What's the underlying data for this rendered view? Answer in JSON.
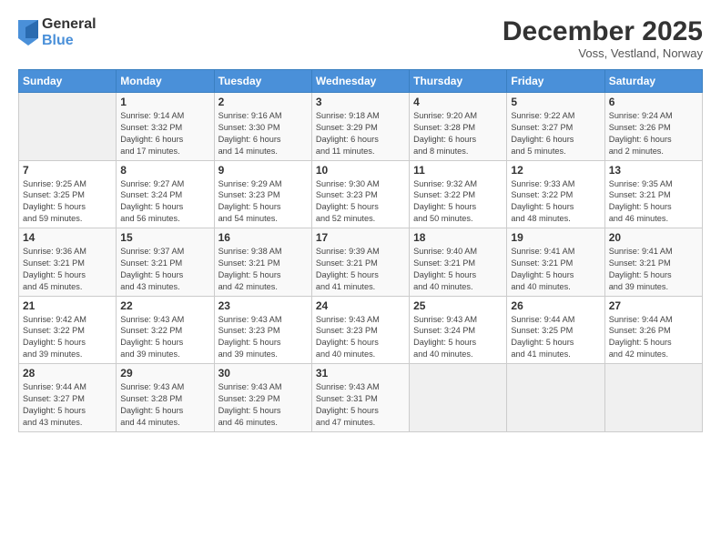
{
  "logo": {
    "general": "General",
    "blue": "Blue"
  },
  "header": {
    "title": "December 2025",
    "subtitle": "Voss, Vestland, Norway"
  },
  "days": [
    "Sunday",
    "Monday",
    "Tuesday",
    "Wednesday",
    "Thursday",
    "Friday",
    "Saturday"
  ],
  "weeks": [
    [
      {
        "day": "",
        "info": ""
      },
      {
        "day": "1",
        "info": "Sunrise: 9:14 AM\nSunset: 3:32 PM\nDaylight: 6 hours\nand 17 minutes."
      },
      {
        "day": "2",
        "info": "Sunrise: 9:16 AM\nSunset: 3:30 PM\nDaylight: 6 hours\nand 14 minutes."
      },
      {
        "day": "3",
        "info": "Sunrise: 9:18 AM\nSunset: 3:29 PM\nDaylight: 6 hours\nand 11 minutes."
      },
      {
        "day": "4",
        "info": "Sunrise: 9:20 AM\nSunset: 3:28 PM\nDaylight: 6 hours\nand 8 minutes."
      },
      {
        "day": "5",
        "info": "Sunrise: 9:22 AM\nSunset: 3:27 PM\nDaylight: 6 hours\nand 5 minutes."
      },
      {
        "day": "6",
        "info": "Sunrise: 9:24 AM\nSunset: 3:26 PM\nDaylight: 6 hours\nand 2 minutes."
      }
    ],
    [
      {
        "day": "7",
        "info": "Sunrise: 9:25 AM\nSunset: 3:25 PM\nDaylight: 5 hours\nand 59 minutes."
      },
      {
        "day": "8",
        "info": "Sunrise: 9:27 AM\nSunset: 3:24 PM\nDaylight: 5 hours\nand 56 minutes."
      },
      {
        "day": "9",
        "info": "Sunrise: 9:29 AM\nSunset: 3:23 PM\nDaylight: 5 hours\nand 54 minutes."
      },
      {
        "day": "10",
        "info": "Sunrise: 9:30 AM\nSunset: 3:23 PM\nDaylight: 5 hours\nand 52 minutes."
      },
      {
        "day": "11",
        "info": "Sunrise: 9:32 AM\nSunset: 3:22 PM\nDaylight: 5 hours\nand 50 minutes."
      },
      {
        "day": "12",
        "info": "Sunrise: 9:33 AM\nSunset: 3:22 PM\nDaylight: 5 hours\nand 48 minutes."
      },
      {
        "day": "13",
        "info": "Sunrise: 9:35 AM\nSunset: 3:21 PM\nDaylight: 5 hours\nand 46 minutes."
      }
    ],
    [
      {
        "day": "14",
        "info": "Sunrise: 9:36 AM\nSunset: 3:21 PM\nDaylight: 5 hours\nand 45 minutes."
      },
      {
        "day": "15",
        "info": "Sunrise: 9:37 AM\nSunset: 3:21 PM\nDaylight: 5 hours\nand 43 minutes."
      },
      {
        "day": "16",
        "info": "Sunrise: 9:38 AM\nSunset: 3:21 PM\nDaylight: 5 hours\nand 42 minutes."
      },
      {
        "day": "17",
        "info": "Sunrise: 9:39 AM\nSunset: 3:21 PM\nDaylight: 5 hours\nand 41 minutes."
      },
      {
        "day": "18",
        "info": "Sunrise: 9:40 AM\nSunset: 3:21 PM\nDaylight: 5 hours\nand 40 minutes."
      },
      {
        "day": "19",
        "info": "Sunrise: 9:41 AM\nSunset: 3:21 PM\nDaylight: 5 hours\nand 40 minutes."
      },
      {
        "day": "20",
        "info": "Sunrise: 9:41 AM\nSunset: 3:21 PM\nDaylight: 5 hours\nand 39 minutes."
      }
    ],
    [
      {
        "day": "21",
        "info": "Sunrise: 9:42 AM\nSunset: 3:22 PM\nDaylight: 5 hours\nand 39 minutes."
      },
      {
        "day": "22",
        "info": "Sunrise: 9:43 AM\nSunset: 3:22 PM\nDaylight: 5 hours\nand 39 minutes."
      },
      {
        "day": "23",
        "info": "Sunrise: 9:43 AM\nSunset: 3:23 PM\nDaylight: 5 hours\nand 39 minutes."
      },
      {
        "day": "24",
        "info": "Sunrise: 9:43 AM\nSunset: 3:23 PM\nDaylight: 5 hours\nand 40 minutes."
      },
      {
        "day": "25",
        "info": "Sunrise: 9:43 AM\nSunset: 3:24 PM\nDaylight: 5 hours\nand 40 minutes."
      },
      {
        "day": "26",
        "info": "Sunrise: 9:44 AM\nSunset: 3:25 PM\nDaylight: 5 hours\nand 41 minutes."
      },
      {
        "day": "27",
        "info": "Sunrise: 9:44 AM\nSunset: 3:26 PM\nDaylight: 5 hours\nand 42 minutes."
      }
    ],
    [
      {
        "day": "28",
        "info": "Sunrise: 9:44 AM\nSunset: 3:27 PM\nDaylight: 5 hours\nand 43 minutes."
      },
      {
        "day": "29",
        "info": "Sunrise: 9:43 AM\nSunset: 3:28 PM\nDaylight: 5 hours\nand 44 minutes."
      },
      {
        "day": "30",
        "info": "Sunrise: 9:43 AM\nSunset: 3:29 PM\nDaylight: 5 hours\nand 46 minutes."
      },
      {
        "day": "31",
        "info": "Sunrise: 9:43 AM\nSunset: 3:31 PM\nDaylight: 5 hours\nand 47 minutes."
      },
      {
        "day": "",
        "info": ""
      },
      {
        "day": "",
        "info": ""
      },
      {
        "day": "",
        "info": ""
      }
    ]
  ]
}
